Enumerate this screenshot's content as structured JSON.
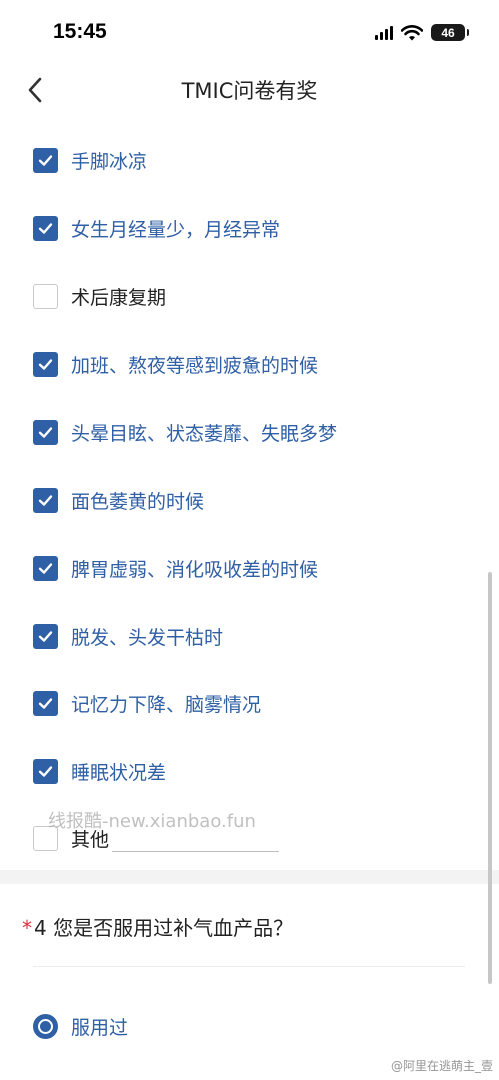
{
  "status_bar": {
    "time": "15:45",
    "battery": "46"
  },
  "header": {
    "title": "TMIC问卷有奖"
  },
  "options": [
    {
      "label": "手脚冰凉",
      "checked": true
    },
    {
      "label": "女生月经量少，月经异常",
      "checked": true
    },
    {
      "label": "术后康复期",
      "checked": false
    },
    {
      "label": "加班、熬夜等感到疲惫的时候",
      "checked": true
    },
    {
      "label": "头晕目眩、状态萎靡、失眠多梦",
      "checked": true
    },
    {
      "label": "面色萎黄的时候",
      "checked": true
    },
    {
      "label": "脾胃虚弱、消化吸收差的时候",
      "checked": true
    },
    {
      "label": "脱发、头发干枯时",
      "checked": true
    },
    {
      "label": "记忆力下降、脑雾情况",
      "checked": true
    },
    {
      "label": "睡眠状况差",
      "checked": true
    },
    {
      "label": "其他",
      "checked": false
    }
  ],
  "other_input": {
    "value": ""
  },
  "watermark": "线报酷-new.xianbao.fun",
  "question4": {
    "required_mark": "*",
    "text": "4 您是否服用过补气血产品？"
  },
  "radio_options": [
    {
      "label": "服用过",
      "selected": true
    }
  ],
  "corner_watermark": "@阿里在逃萌主_壹",
  "colors": {
    "accent": "#2f5fa5",
    "required": "#d9303e"
  }
}
